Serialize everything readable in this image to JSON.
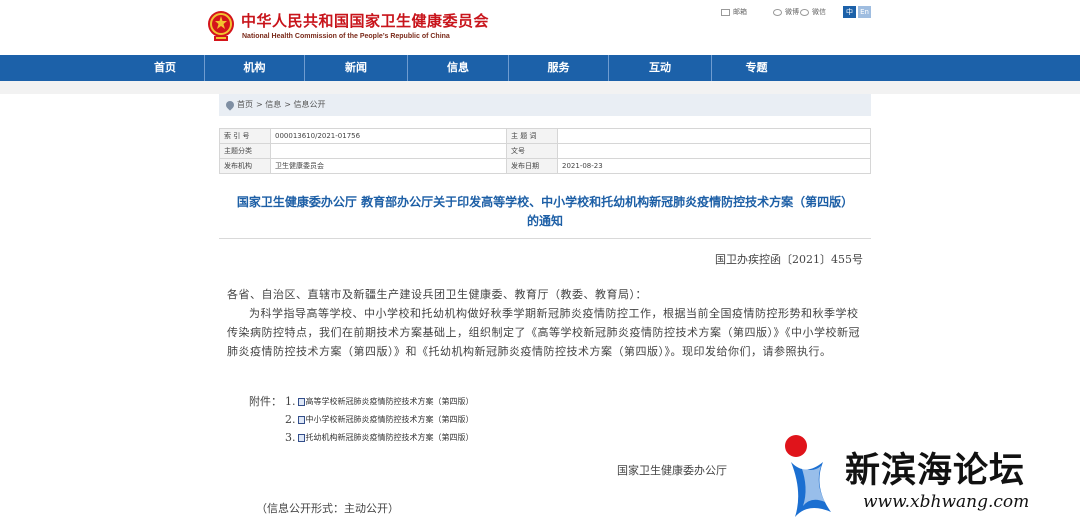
{
  "header": {
    "title": "中华人民共和国国家卫生健康委员会",
    "subtitle": "National Health Commission of the People’s Republic of China",
    "share": [
      {
        "label": "邮箱",
        "icon": "mail-icon"
      },
      {
        "label": "微博",
        "icon": "weibo-icon"
      },
      {
        "label": "微信",
        "icon": "wechat-icon"
      }
    ],
    "lang": [
      "中",
      "En"
    ]
  },
  "nav": [
    "首页",
    "机构",
    "新闻",
    "信息",
    "服务",
    "互动",
    "专题"
  ],
  "breadcrumb": [
    "首页",
    "> 信息",
    "> 信息公开"
  ],
  "meta": {
    "rows": [
      {
        "k1": "索 引 号",
        "v1": "000013610/2021-01756",
        "k2": "主 题 词",
        "v2": ""
      },
      {
        "k1": "主题分类",
        "v1": "",
        "k2": "文号",
        "v2": ""
      },
      {
        "k1": "发布机构",
        "v1": "卫生健康委员会",
        "k2": "发布日期",
        "v2": "2021-08-23"
      }
    ]
  },
  "doc": {
    "title_line1": "国家卫生健康委办公厅 教育部办公厅关于印发高等学校、中小学校和托幼机构新冠肺炎疫情防控技术方案（第四版）",
    "title_line2": "的通知",
    "number": "国卫办疾控函〔2021〕455号",
    "salutation": "各省、自治区、直辖市及新疆生产建设兵团卫生健康委、教育厅（教委、教育局）：",
    "paragraph": "为科学指导高等学校、中小学校和托幼机构做好秋季学期新冠肺炎疫情防控工作，根据当前全国疫情防控形势和秋季学校传染病防控特点，我们在前期技术方案基础上，组织制定了《高等学校新冠肺炎疫情防控技术方案（第四版）》《中小学校新冠肺炎疫情防控技术方案（第四版）》和《托幼机构新冠肺炎疫情防控技术方案（第四版）》。现印发给你们，请参照执行。",
    "attach_label": "附件：",
    "attachments": [
      {
        "num": "1.",
        "name": "高等学校新冠肺炎疫情防控技术方案（第四版）"
      },
      {
        "num": "2.",
        "name": "中小学校新冠肺炎疫情防控技术方案（第四版）"
      },
      {
        "num": "3.",
        "name": "托幼机构新冠肺炎疫情防控技术方案（第四版）"
      }
    ],
    "signer": "国家卫生健康委办公厅",
    "publish": "（信息公开形式：主动公开）"
  },
  "watermark": {
    "name": "新滨海论坛",
    "url": "www.xbhwang.com"
  },
  "colors": {
    "nav": "#1c61a9",
    "title": "#1d5fa6",
    "site_title": "#c8141b"
  }
}
